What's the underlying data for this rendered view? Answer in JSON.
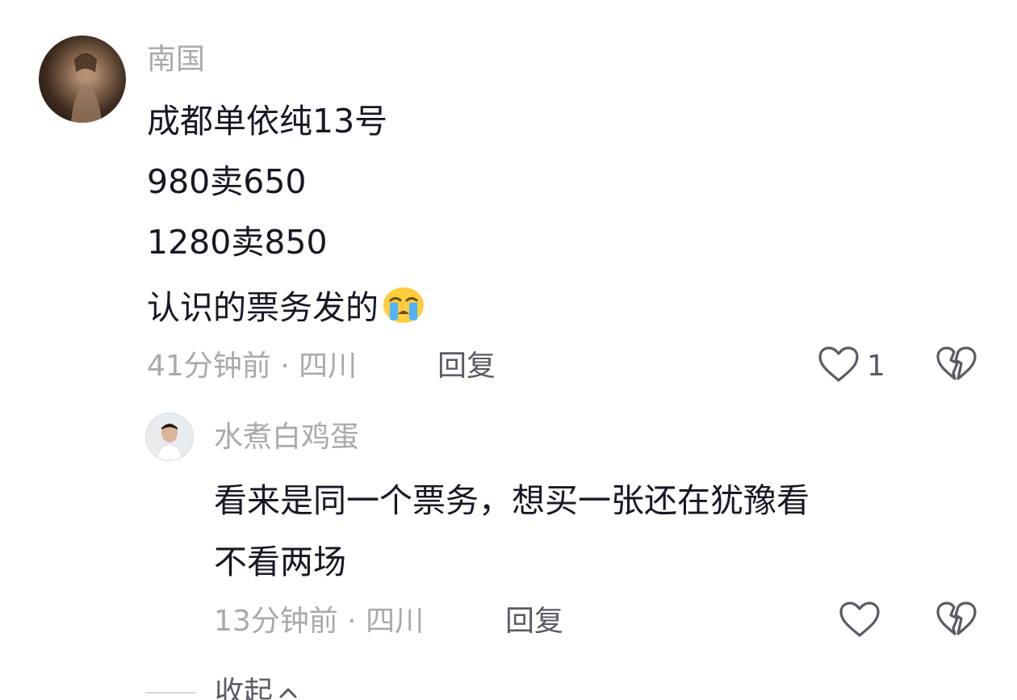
{
  "comment": {
    "username": "南国",
    "lines": [
      "成都单依纯13号",
      "980卖650",
      "1280卖850",
      "认识的票务发的"
    ],
    "time": "41分钟前",
    "location": "四川",
    "reply_label": "回复",
    "like_count": "1",
    "emoji": "loudly-crying-face"
  },
  "reply": {
    "username": "水煮白鸡蛋",
    "lines": [
      "看来是同一个票务，想买一张还在犹豫看",
      "不看两场"
    ],
    "time": "13分钟前",
    "location": "四川",
    "reply_label": "回复"
  },
  "meta_separator": " · ",
  "collapse_label": "收起"
}
